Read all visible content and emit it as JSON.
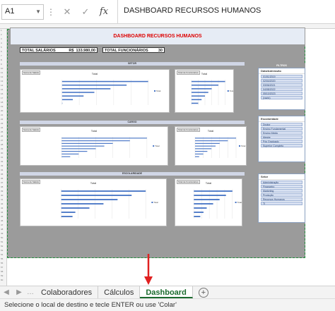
{
  "formula_bar": {
    "cell_ref": "A1",
    "cancel_icon": "✕",
    "enter_icon": "✓",
    "fx": "fx",
    "content": "DASHBOARD RECURSOS HUMANOS"
  },
  "dashboard": {
    "title": "DASHBOARD RECURSOS HUMANOS",
    "kpi_salarios_label": "TOTAL SALÁRIOS",
    "kpi_salarios_currency": "R$",
    "kpi_salarios_value": "133.980,00",
    "kpi_func_label": "TOTAL FUNCIONÁRIOS",
    "kpi_func_value": "30",
    "band_setor": "SETOR",
    "band_cargo": "CARGO",
    "band_escolaridade": "ESCOLARIDADE",
    "chart_title": "Total",
    "tag_salario": "Soma de Salário",
    "tag_func": "Total de Funcionários",
    "legend": "Total"
  },
  "chart_data": [
    {
      "type": "bar",
      "title": "Total",
      "values": [
        160000,
        120000,
        90000,
        60000,
        40000,
        20000,
        0
      ]
    },
    {
      "type": "bar",
      "title": "Total",
      "values": [
        10,
        8,
        6,
        5,
        4,
        3,
        2
      ]
    },
    {
      "type": "bar",
      "title": "Total",
      "values": [
        50000,
        40000,
        30000,
        25000,
        20000,
        15000,
        10000,
        5000
      ]
    },
    {
      "type": "bar",
      "title": "Total",
      "values": [
        10,
        8,
        6,
        5,
        4,
        3,
        2,
        1
      ]
    },
    {
      "type": "bar",
      "title": "Total",
      "values": [
        60000,
        50000,
        40000,
        30000,
        20000,
        10000,
        8000
      ]
    },
    {
      "type": "bar",
      "title": "Total",
      "values": [
        12,
        10,
        8,
        6,
        4,
        3,
        2
      ]
    }
  ],
  "slicers": {
    "filtros": "FILTROS",
    "s1_title": "Data/Admissão",
    "s1_items": [
      "01/01/2019",
      "02/04/2020",
      "03/06/2021",
      "04/08/2022",
      "05/10/2023",
      "(vazio)"
    ],
    "s2_title": "Escolaridade",
    "s2_items": [
      "Doutor",
      "Ensino Fundamental",
      "Ensino Médio",
      "Mestre",
      "Pós Graduado",
      "Superior Completo"
    ],
    "s3_title": "Setor",
    "s3_items": [
      "Administração",
      "Financeiro",
      "Marketing",
      "Produção",
      "Recursos Humanos",
      "TI"
    ]
  },
  "tabs": {
    "prev": "◀",
    "next": "▶",
    "tab1": "Colaboradores",
    "tab2": "Cálculos",
    "tab3": "Dashboard",
    "add": "+"
  },
  "status": "Selecione o local de destino e tecle ENTER ou use 'Colar'",
  "colors": {
    "accent": "#1b6b2e",
    "title_red": "#dd0000",
    "bar": "#4472c4",
    "arrow": "#e02020"
  }
}
